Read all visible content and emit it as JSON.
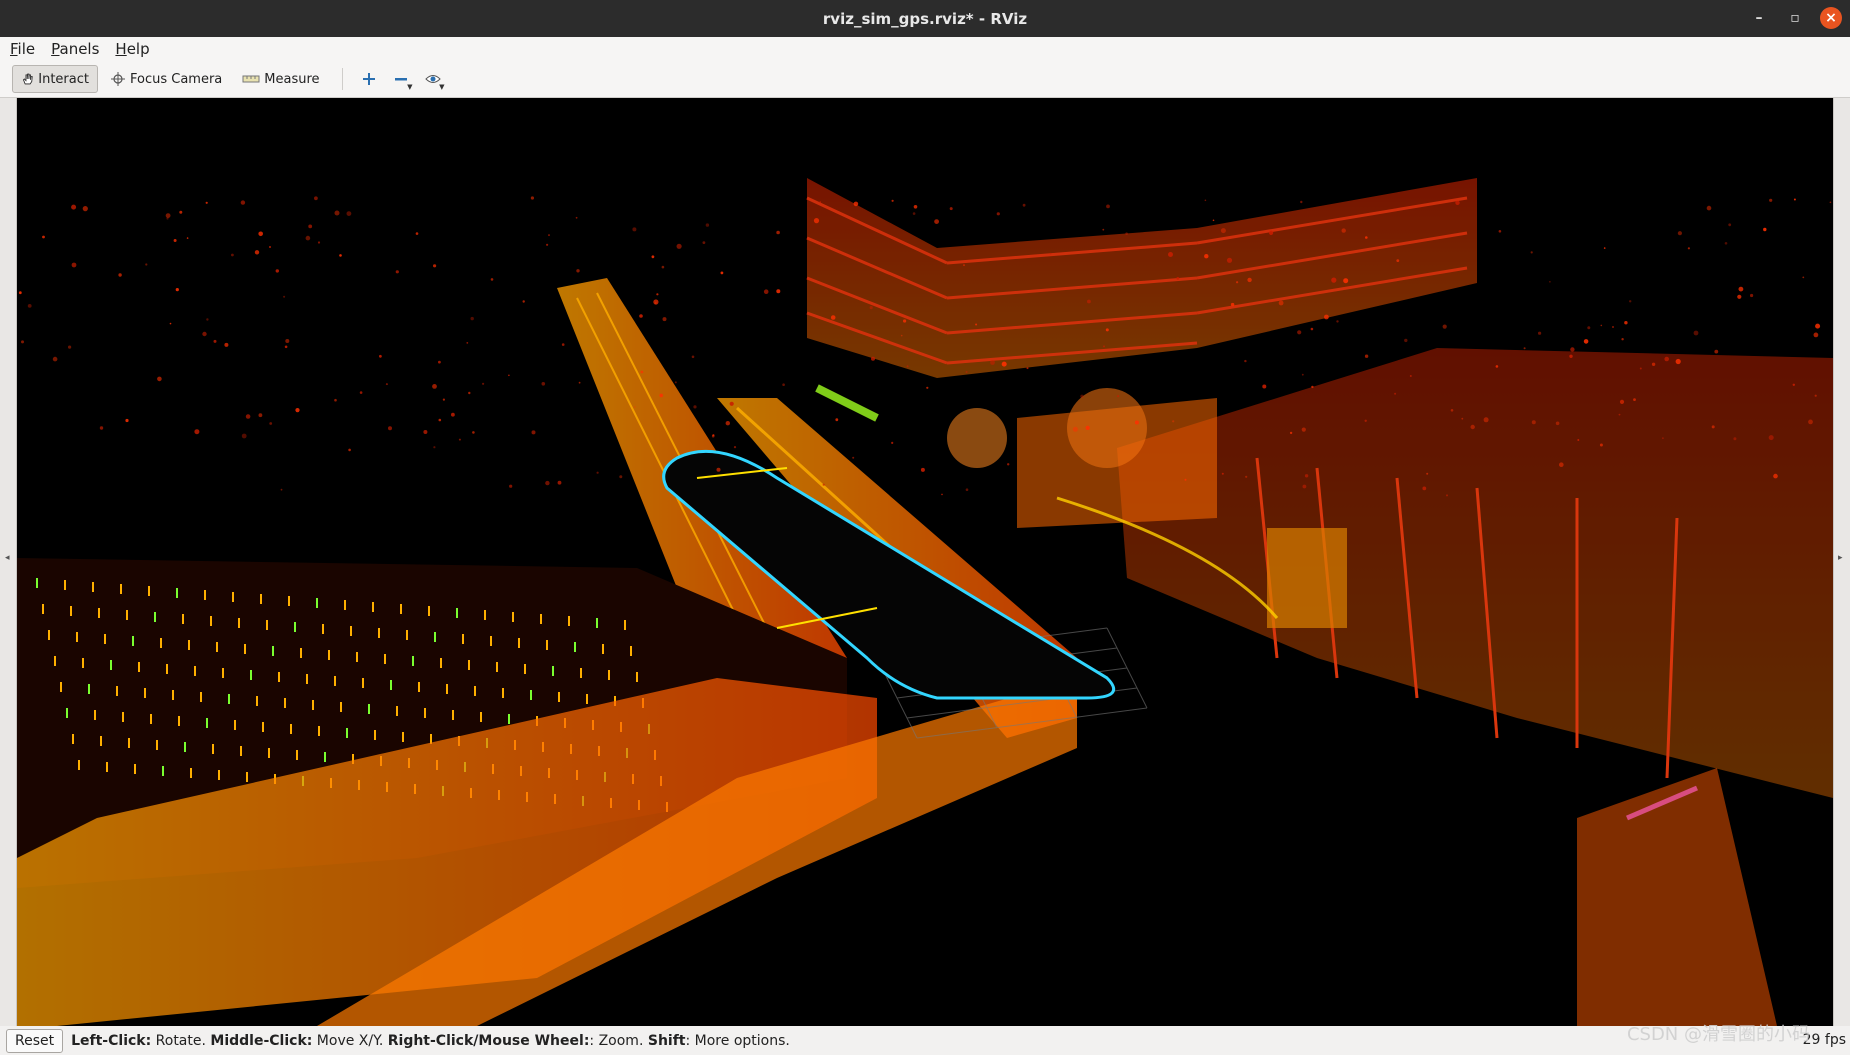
{
  "window": {
    "title": "rviz_sim_gps.rviz* - RViz",
    "controls": [
      "–",
      "▫",
      "×"
    ]
  },
  "menubar": [
    {
      "mnemonic": "F",
      "rest": "ile"
    },
    {
      "mnemonic": "P",
      "rest": "anels"
    },
    {
      "mnemonic": "H",
      "rest": "elp"
    }
  ],
  "toolbar": {
    "interact_label": "Interact",
    "focus_camera_label": "Focus Camera",
    "measure_label": "Measure",
    "icons": [
      "hand-icon",
      "crosshair-icon",
      "ruler-icon",
      "plus-icon",
      "minus-icon",
      "eye-icon"
    ]
  },
  "statusbar": {
    "reset_label": "Reset",
    "hints": [
      {
        "key": "Left-Click:",
        "action": " Rotate. "
      },
      {
        "key": "Middle-Click:",
        "action": " Move X/Y. "
      },
      {
        "key": "Right-Click/Mouse Wheel:",
        "action": ": Zoom. "
      },
      {
        "key": "Shift",
        "action": ": More options."
      }
    ],
    "fps": "29 fps"
  },
  "watermark": "CSDN @滑雪圈的小码",
  "colors": {
    "accent": "#e95420",
    "pointcloud_hot": "#ff3b00",
    "pointcloud_warm": "#ff9a00",
    "trajectory": "#33d6ff"
  }
}
